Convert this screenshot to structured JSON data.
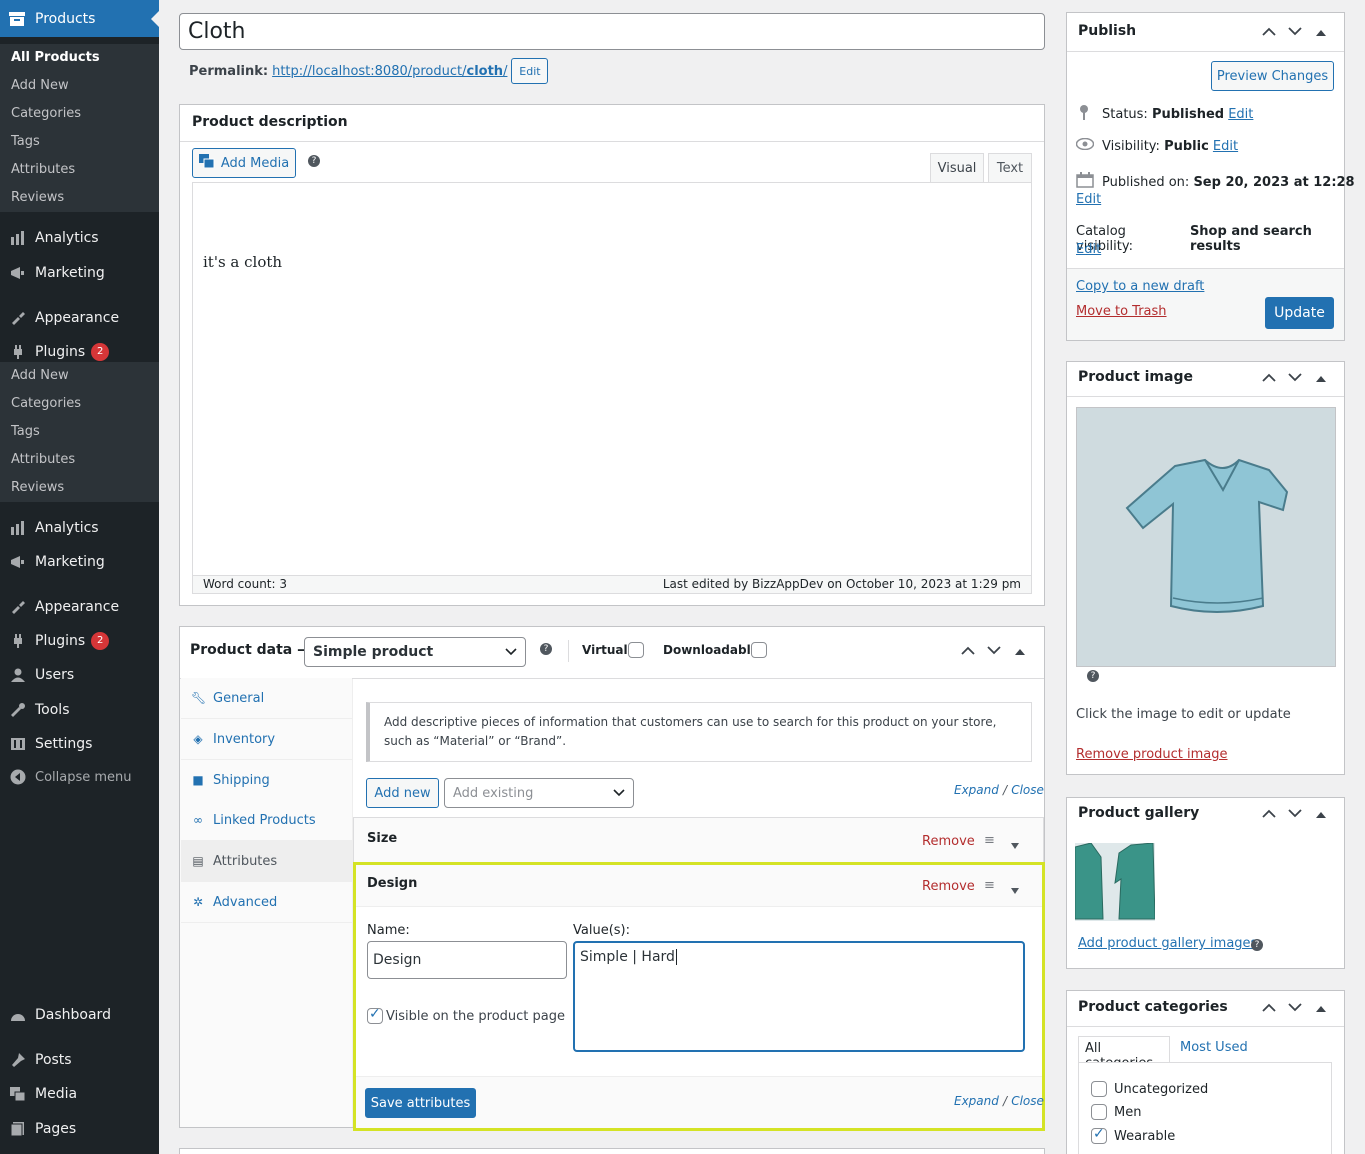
{
  "sidebar": {
    "current": "Products",
    "products_sub": [
      "All Products",
      "Add New",
      "Categories",
      "Tags",
      "Attributes",
      "Reviews"
    ],
    "menu_a": [
      "Analytics",
      "Marketing",
      "Appearance",
      "Plugins"
    ],
    "plugins_badge": "2",
    "sub2": [
      "Add New",
      "Categories",
      "Tags",
      "Attributes",
      "Reviews"
    ],
    "menu_b": [
      "Analytics",
      "Marketing",
      "Appearance",
      "Plugins",
      "Users",
      "Tools",
      "Settings"
    ],
    "collapse": "Collapse menu",
    "menu_c": [
      "Dashboard",
      "Posts",
      "Media",
      "Pages"
    ]
  },
  "post": {
    "title": "Cloth",
    "permalink_label": "Permalink:",
    "permalink_base": "http://localhost:8080/product/",
    "permalink_slug": "cloth",
    "permalink_end": "/",
    "edit_btn": "Edit"
  },
  "description": {
    "heading": "Product description",
    "add_media": "Add Media",
    "tab_visual": "Visual",
    "tab_text": "Text",
    "content": "it's a cloth",
    "word_count": "Word count: 3",
    "last_edited": "Last edited by BizzAppDev on October 10, 2023 at 1:29 pm"
  },
  "product_data": {
    "heading": "Product data —",
    "type": "Simple product",
    "virtual": "Virtual:",
    "downloadable": "Downloadable:",
    "tabs": [
      "General",
      "Inventory",
      "Shipping",
      "Linked Products",
      "Attributes",
      "Advanced"
    ],
    "info": "Add descriptive pieces of information that customers can use to search for this product on your store, such as “Material” or “Brand”.",
    "add_new": "Add new",
    "add_existing": "Add existing",
    "expand": "Expand",
    "close": "Close",
    "slash": "/",
    "attributes": [
      {
        "name": "Size",
        "remove": "Remove"
      },
      {
        "name": "Design",
        "remove": "Remove"
      }
    ],
    "name_label": "Name:",
    "name_value": "Design",
    "values_label": "Value(s):",
    "values_value": "Simple | Hard",
    "visible_label": "Visible on the product page",
    "save": "Save attributes"
  },
  "publish": {
    "heading": "Publish",
    "preview": "Preview Changes",
    "status_label": "Status:",
    "status_value": "Published",
    "visibility_label": "Visibility:",
    "visibility_value": "Public",
    "published_label": "Published on:",
    "published_value": "Sep 20, 2023 at 12:28",
    "catalog_label": "Catalog visibility:",
    "catalog_value": "Shop and search results",
    "edit": "Edit",
    "copy": "Copy to a new draft",
    "trash": "Move to Trash",
    "update": "Update"
  },
  "product_image": {
    "heading": "Product image",
    "hint": "Click the image to edit or update",
    "remove": "Remove product image"
  },
  "gallery": {
    "heading": "Product gallery",
    "add": "Add product gallery images"
  },
  "categories": {
    "heading": "Product categories",
    "tab_all": "All categories",
    "tab_used": "Most Used",
    "items": [
      {
        "label": "Uncategorized",
        "checked": false
      },
      {
        "label": "Men",
        "checked": false
      },
      {
        "label": "Wearable",
        "checked": true
      }
    ]
  },
  "colors": {
    "accent": "#2271b1",
    "highlight": "#d4e325",
    "danger": "#b32d2e"
  }
}
